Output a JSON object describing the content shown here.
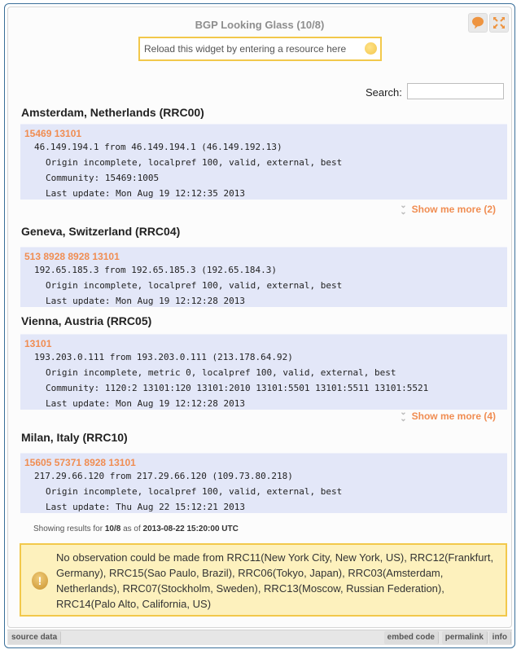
{
  "header": {
    "title": "BGP Looking Glass (10/8)",
    "feedback_icon": "speech-bubble-icon",
    "expand_icon": "expand-arrows-icon"
  },
  "reload_box": {
    "placeholder": "Reload this widget by entering a resource here",
    "icon": "yellow-dot-icon"
  },
  "search": {
    "label": "Search:",
    "value": "",
    "placeholder": ""
  },
  "colors": {
    "accent_orange": "#f08d52",
    "route_bg": "#e3e7f8",
    "warning_bg": "#fdf1bd",
    "warning_border": "#f2c84b",
    "frame_border": "#3a6f99"
  },
  "collectors": [
    {
      "title": "Amsterdam, Netherlands (RRC00)",
      "as_path": "15469 13101",
      "lines": [
        "46.149.194.1 from 46.149.194.1 (46.149.192.13)",
        "Origin incomplete, localpref 100, valid, external, best",
        "Community: 15469:1005",
        "Last update: Mon Aug 19 12:12:35 2013"
      ],
      "show_more": "Show me more (2)"
    },
    {
      "title": "Geneva, Switzerland (RRC04)",
      "as_path": "513 8928 8928 13101",
      "lines": [
        "192.65.185.3 from 192.65.185.3 (192.65.184.3)",
        "Origin incomplete, localpref 100, valid, external, best",
        "Last update: Mon Aug 19 12:12:28 2013"
      ],
      "show_more": null
    },
    {
      "title": "Vienna, Austria (RRC05)",
      "as_path": "13101",
      "lines": [
        "193.203.0.111 from 193.203.0.111 (213.178.64.92)",
        "Origin incomplete, metric 0, localpref 100, valid, external, best",
        "Community: 1120:2 13101:120 13101:2010 13101:5501 13101:5511 13101:5521",
        "Last update: Mon Aug 19 12:12:28 2013"
      ],
      "show_more": "Show me more (4)"
    },
    {
      "title": "Milan, Italy (RRC10)",
      "as_path": "15605 57371 8928 13101",
      "lines": [
        "217.29.66.120 from 217.29.66.120 (109.73.80.218)",
        "Origin incomplete, localpref 100, valid, external, best",
        "Last update: Thu Aug 22 15:12:21 2013"
      ],
      "show_more": null
    }
  ],
  "status": {
    "prefix": "Showing results for",
    "resource": "10/8",
    "middle": "as of",
    "timestamp": "2013-08-22 15:20:00 UTC"
  },
  "warning": {
    "icon": "exclamation-icon",
    "text": "No observation could be made from RRC11(New York City, New York, US), RRC12(Frankfurt, Germany), RRC15(Sao Paulo, Brazil), RRC06(Tokyo, Japan), RRC03(Amsterdam, Netherlands), RRC07(Stockholm, Sweden), RRC13(Moscow, Russian Federation), RRC14(Palo Alto, California, US)"
  },
  "footer": {
    "source_data": "source data",
    "embed_code": "embed code",
    "permalink": "permalink",
    "info": "info"
  }
}
